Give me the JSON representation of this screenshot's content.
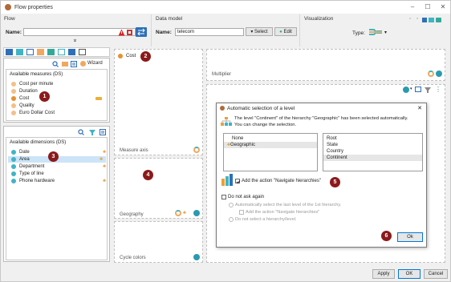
{
  "window": {
    "title": "Flow properties",
    "minimize": "–",
    "maximize": "☐",
    "close": "✕"
  },
  "flow": {
    "header": "Flow",
    "name_label": "Name:",
    "name_value": "",
    "expand_glyph": "»"
  },
  "data_model": {
    "header": "Data model",
    "name_label": "Name:",
    "name_value": "telecom",
    "select_label": "Select",
    "edit_label": "Edit"
  },
  "visualization": {
    "header": "Visualization",
    "type_label": "Type:"
  },
  "measures": {
    "wizard_label": "Wizard",
    "title": "Available measures (DS)",
    "items": [
      "Cost per minute",
      "Duration",
      "Cost",
      "Quality",
      "Euro Dollar Cost"
    ]
  },
  "dimensions": {
    "title": "Available dimensions (DS)",
    "items": [
      "Date",
      "Area",
      "Department",
      "Type of line",
      "Phone hardware"
    ]
  },
  "zones": {
    "cost_chip": "Cost",
    "measure_axis": "Measure axis",
    "geography": "Geography",
    "cycle_colors": "Cycle colors",
    "multiplier": "Multiplier"
  },
  "dialog": {
    "title": "Automatic selection of a level",
    "close": "✕",
    "message_line1": "The level \"Continent\" of the hierarchy \"Geographic\" has been selected automatically.",
    "message_line2": "You can change the selection.",
    "hierarchies": [
      "None",
      "Geographic"
    ],
    "levels": [
      "Root",
      "State",
      "Country",
      "Continent"
    ],
    "add_action_label": "Add the action \"Navigate hierarchies\"",
    "do_not_ask": "Do not ask again",
    "opt1": "Automatically select the last level of the 1st hierarchy.",
    "opt1_sub": "Add the action \"Navigate hierarchies\"",
    "opt2": "Do not select a hierarchy/level.",
    "ok": "Ok"
  },
  "footer": {
    "apply": "Apply",
    "ok": "OK",
    "cancel": "Cancel"
  },
  "badges": [
    "1",
    "2",
    "3",
    "4",
    "5",
    "6"
  ],
  "colors": {
    "badge": "#8b1a1a",
    "accent_blue": "#2e6fb8",
    "selection": "#cce4f7",
    "orange_dot": "#f0a860",
    "teal_dot": "#3fb4c4"
  }
}
